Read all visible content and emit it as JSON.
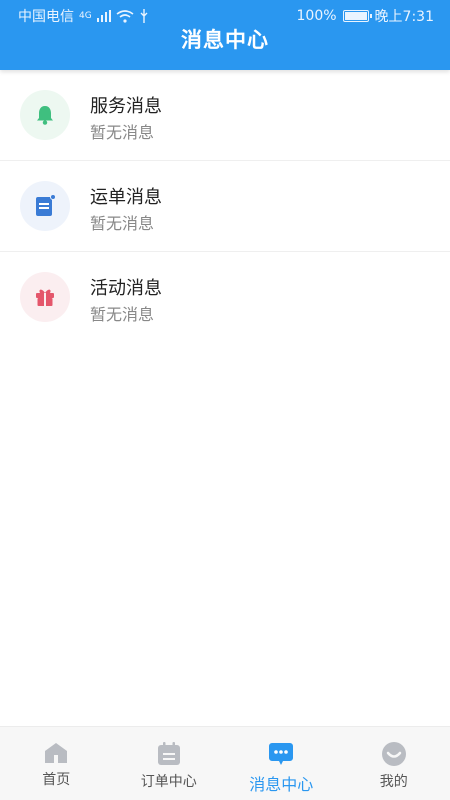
{
  "status_bar": {
    "carrier": "中国电信",
    "network": "4G",
    "battery_pct": "100%",
    "time": "晚上7:31"
  },
  "header": {
    "title": "消息中心"
  },
  "colors": {
    "primary": "#2a97f0",
    "service_icon": "#3fbf7f",
    "waybill_icon": "#3a7bd5",
    "activity_icon": "#e4566b"
  },
  "messages": [
    {
      "title": "服务消息",
      "subtitle": "暂无消息",
      "icon": "bell-icon"
    },
    {
      "title": "运单消息",
      "subtitle": "暂无消息",
      "icon": "document-icon"
    },
    {
      "title": "活动消息",
      "subtitle": "暂无消息",
      "icon": "gift-icon"
    }
  ],
  "tabs": [
    {
      "label": "首页",
      "icon": "home-icon",
      "active": false
    },
    {
      "label": "订单中心",
      "icon": "calendar-icon",
      "active": false
    },
    {
      "label": "消息中心",
      "icon": "chat-icon",
      "active": true
    },
    {
      "label": "我的",
      "icon": "profile-icon",
      "active": false
    }
  ]
}
